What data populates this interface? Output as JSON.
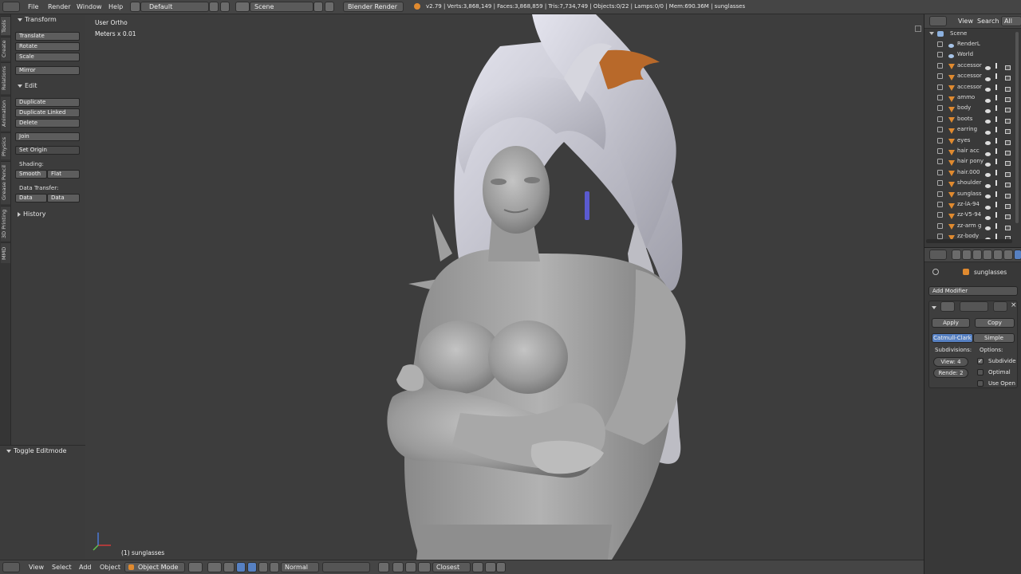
{
  "topbar": {
    "menus": [
      "File",
      "Render",
      "Window",
      "Help"
    ],
    "layout": "Default",
    "scene": "Scene",
    "engine": "Blender Render",
    "stats": "v2.79 | Verts:3,868,149 | Faces:3,868,859 | Tris:7,734,749 | Objects:0/22 | Lamps:0/0 | Mem:690.36M | sunglasses"
  },
  "side_tabs": [
    "Tools",
    "Create",
    "Relations",
    "Animation",
    "Physics",
    "Grease Pencil",
    "3D Printing",
    "MMD"
  ],
  "tool_shelf": {
    "transform_header": "Transform",
    "translate": "Translate",
    "rotate": "Rotate",
    "scale": "Scale",
    "mirror": "Mirror",
    "edit_header": "Edit",
    "duplicate": "Duplicate",
    "duplicate_linked": "Duplicate Linked",
    "delete": "Delete",
    "join": "Join",
    "set_origin": "Set Origin",
    "shading_label": "Shading:",
    "smooth": "Smooth",
    "flat": "Flat",
    "data_transfer_label": "Data Transfer:",
    "data": "Data",
    "data_layout": "Data Layo",
    "history_header": "History"
  },
  "redo_panel": {
    "title": "Toggle Editmode"
  },
  "viewport": {
    "view_name": "User Ortho",
    "units": "Meters x 0.01",
    "active_object": "(1) sunglasses"
  },
  "bottombar": {
    "menus": [
      "View",
      "Select",
      "Add",
      "Object"
    ],
    "mode": "Object Mode",
    "orientation": "Normal",
    "snap": "Closest"
  },
  "outliner": {
    "view": "View",
    "search": "Search",
    "filter": "All Sc",
    "scene": "Scene",
    "items": [
      "RenderL",
      "World",
      "accessor",
      "accessor",
      "accessor",
      "ammo",
      "body",
      "boots",
      "earring",
      "eyes",
      "hair acc",
      "hair pony",
      "hair.000",
      "shoulder",
      "sunglass",
      "zz-lA-94",
      "zz-V5-94",
      "zz-arm g",
      "zz-body"
    ]
  },
  "properties": {
    "object_name": "sunglasses",
    "add_modifier": "Add Modifier",
    "apply": "Apply",
    "copy": "Copy",
    "catmull_clark": "Catmull-Clark",
    "simple": "Simple",
    "subdivisions_label": "Subdivisions:",
    "options_label": "Options:",
    "view_field": "View:  4",
    "render_field": "Rende: 2",
    "subdivide_uvs": "Subdivide",
    "optimal_display": "Optimal",
    "use_opensubdiv": "Use Open"
  },
  "colors": {
    "accent": "#5680c2",
    "background": "#3d3d3d",
    "model": "#a9a9a9",
    "hair_accent": "#b8692a"
  }
}
